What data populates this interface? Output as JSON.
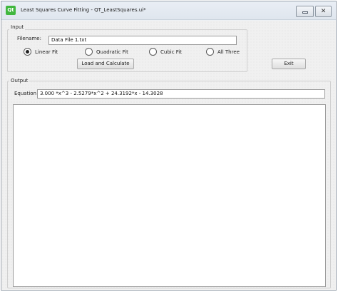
{
  "window": {
    "title": "Least Squares Curve Fitting - QT_LeastSquares.ui*",
    "icon_text": "Qt",
    "close_glyph": "✕"
  },
  "input_group": {
    "title": "Input",
    "filename_label": "Filename:",
    "filename_value": "Data File 1.txt",
    "fit_options": [
      {
        "label": "Linear Fit",
        "selected": true
      },
      {
        "label": "Quadratic Fit",
        "selected": false
      },
      {
        "label": "Cubic Fit",
        "selected": false
      },
      {
        "label": "All Three",
        "selected": false
      }
    ],
    "load_button": "Load and Calculate"
  },
  "exit_button": "Exit",
  "output_group": {
    "title": "Output",
    "equation_label": "Equation",
    "equation_value": "3.000 *x^3 - 2.5279*x^2 + 24.3192*x - 14.3028",
    "output_text": ""
  }
}
